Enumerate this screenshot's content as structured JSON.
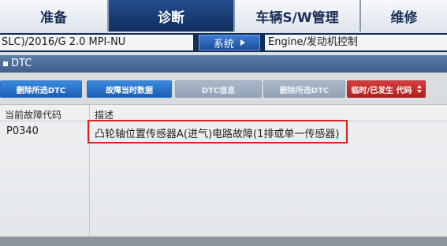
{
  "tabs": [
    {
      "label": "准备",
      "active": false
    },
    {
      "label": "诊断",
      "active": true
    },
    {
      "label": "车辆S/W管理",
      "active": false
    },
    {
      "label": "维修",
      "active": false
    }
  ],
  "vehicle": {
    "model": "SLC)/2016/G 2.0 MPI-NU",
    "system_button": "系统",
    "system_name": "Engine/发动机控制"
  },
  "panel": {
    "title": "DTC"
  },
  "buttons": {
    "clear_all": "删除所选DTC",
    "freeze_frame": "故障当时数据",
    "dtc_info": "DTC信息",
    "clear_selected": "删除所选DTC",
    "code_filter": "临时/已发生 代码"
  },
  "table": {
    "headers": {
      "code": "当前故障代码",
      "description": "描述"
    },
    "rows": [
      {
        "code": "P0340",
        "description": "凸轮轴位置传感器A(进气)电路故障(1排或单一传感器)"
      }
    ]
  },
  "colors": {
    "nav_dark": "#0e2f63",
    "active_tab": "#254d8f",
    "panel_header": "#4a6c98",
    "button_blue": "#1c5eb4",
    "button_disabled": "#a3b2c4",
    "button_red": "#c02a2a",
    "highlight": "#e02020"
  },
  "icons": {
    "system_button": "play-icon",
    "code_filter": "up-down-arrow-icon",
    "panel_header": "square-bullet-icon"
  }
}
